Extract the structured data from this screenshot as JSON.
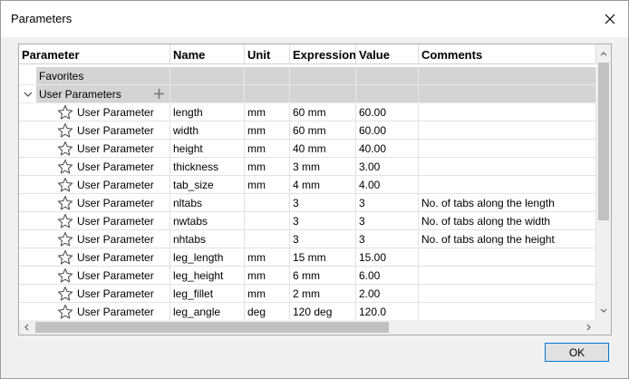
{
  "window": {
    "title": "Parameters"
  },
  "table": {
    "columns": [
      "Parameter",
      "Name",
      "Unit",
      "Expression",
      "Value",
      "Comments"
    ],
    "favorites_label": "Favorites",
    "user_parameters_label": "User Parameters",
    "rows": [
      {
        "param": "User Parameter",
        "name": "length",
        "unit": "mm",
        "expression": "60 mm",
        "value": "60.00",
        "comment": ""
      },
      {
        "param": "User Parameter",
        "name": "width",
        "unit": "mm",
        "expression": "60 mm",
        "value": "60.00",
        "comment": ""
      },
      {
        "param": "User Parameter",
        "name": "height",
        "unit": "mm",
        "expression": "40 mm",
        "value": "40.00",
        "comment": ""
      },
      {
        "param": "User Parameter",
        "name": "thickness",
        "unit": "mm",
        "expression": "3 mm",
        "value": "3.00",
        "comment": ""
      },
      {
        "param": "User Parameter",
        "name": "tab_size",
        "unit": "mm",
        "expression": "4 mm",
        "value": "4.00",
        "comment": ""
      },
      {
        "param": "User Parameter",
        "name": "nltabs",
        "unit": "",
        "expression": "3",
        "value": "3",
        "comment": "No. of tabs along the length"
      },
      {
        "param": "User Parameter",
        "name": "nwtabs",
        "unit": "",
        "expression": "3",
        "value": "3",
        "comment": "No. of tabs along the width"
      },
      {
        "param": "User Parameter",
        "name": "nhtabs",
        "unit": "",
        "expression": "3",
        "value": "3",
        "comment": "No. of tabs along the height"
      },
      {
        "param": "User Parameter",
        "name": "leg_length",
        "unit": "mm",
        "expression": "15 mm",
        "value": "15.00",
        "comment": ""
      },
      {
        "param": "User Parameter",
        "name": "leg_height",
        "unit": "mm",
        "expression": "6 mm",
        "value": "6.00",
        "comment": ""
      },
      {
        "param": "User Parameter",
        "name": "leg_fillet",
        "unit": "mm",
        "expression": "2 mm",
        "value": "2.00",
        "comment": ""
      },
      {
        "param": "User Parameter",
        "name": "leg_angle",
        "unit": "deg",
        "expression": "120 deg",
        "value": "120.0",
        "comment": ""
      }
    ]
  },
  "buttons": {
    "ok": "OK"
  },
  "icons": {
    "close": "close-icon",
    "expand": "chevron-down-icon",
    "add": "plus-icon",
    "favorite": "star-outline-icon"
  }
}
